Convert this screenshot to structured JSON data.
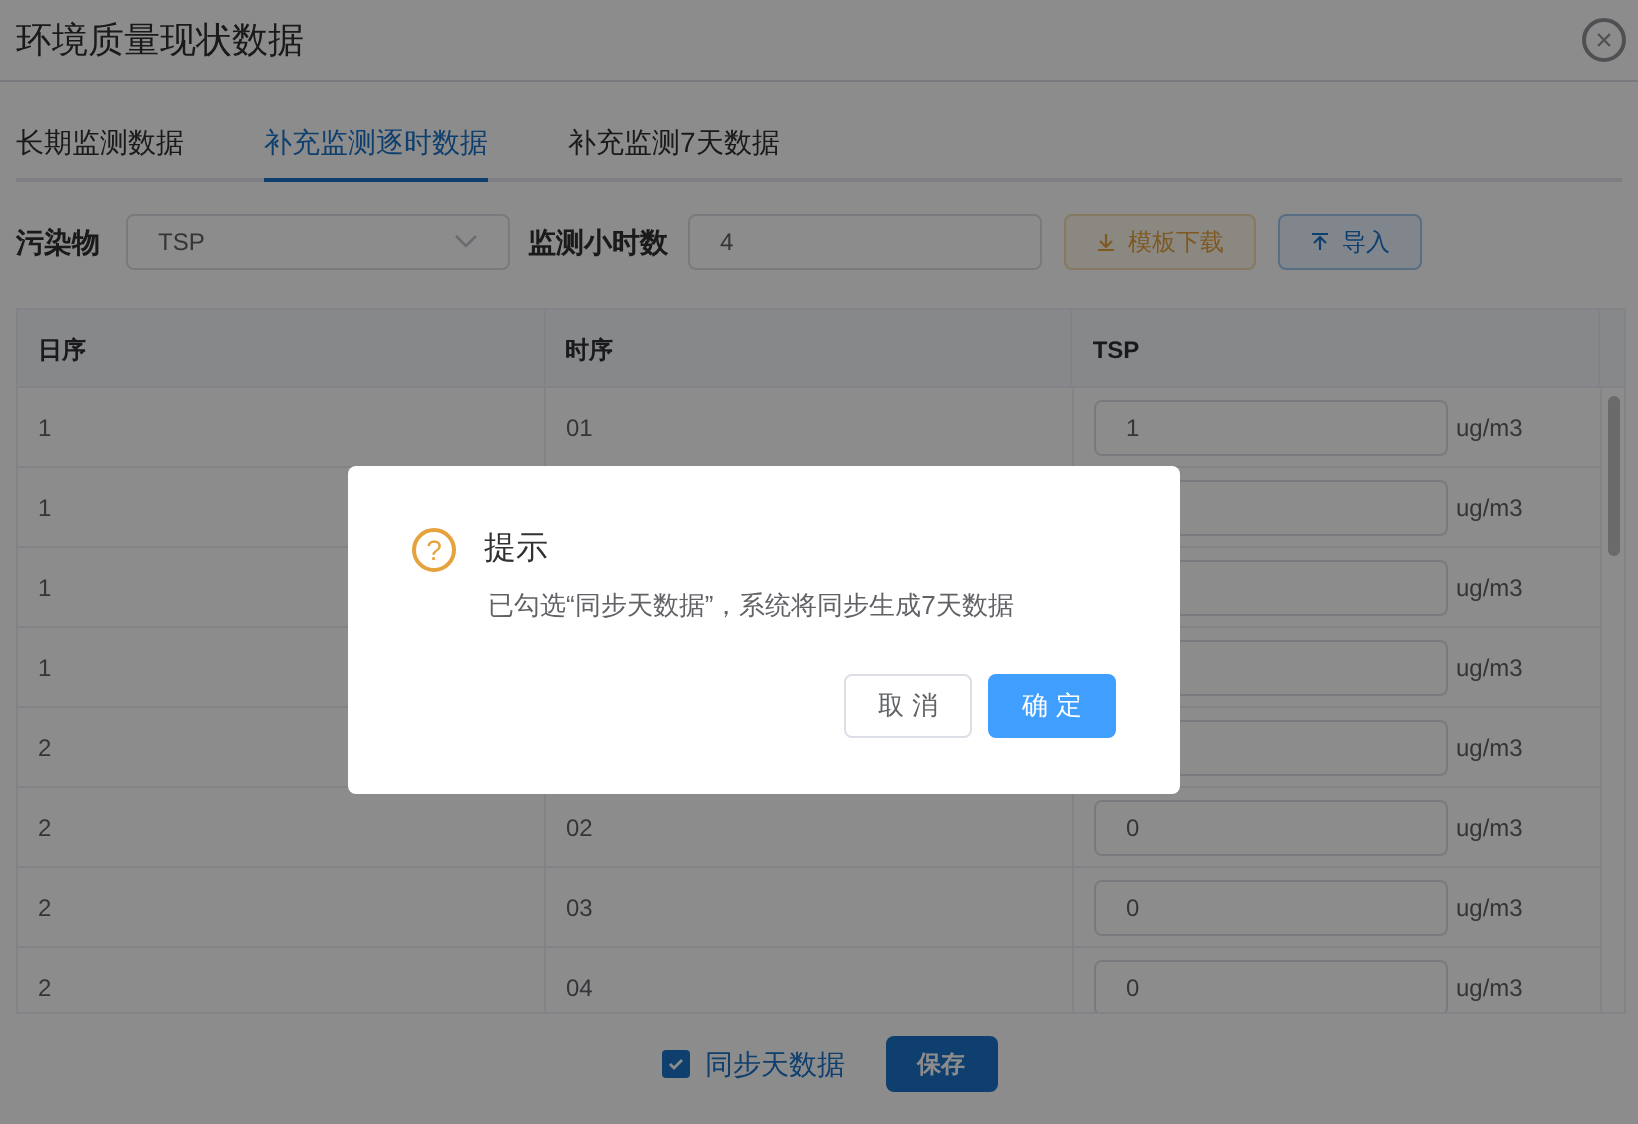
{
  "dialog": {
    "title": "环境质量现状数据",
    "close": "×"
  },
  "tabs": [
    {
      "label": "长期监测数据",
      "selected": false
    },
    {
      "label": "补充监测逐时数据",
      "selected": true
    },
    {
      "label": "补充监测7天数据",
      "selected": false
    }
  ],
  "filters": {
    "pollutant_label": "污染物",
    "pollutant": "TSP",
    "hours_label": "监测小时数",
    "hours": "4",
    "template_button": "模板下载",
    "import_button": "导入"
  },
  "table": {
    "columns": [
      "日序",
      "时序",
      "TSP"
    ],
    "rows": [
      {
        "day": "1",
        "hour": "01",
        "value": "1",
        "unit": "ug/m3"
      },
      {
        "day": "1",
        "unit": "ug/m3"
      },
      {
        "day": "1",
        "unit": "ug/m3"
      },
      {
        "day": "1",
        "unit": "ug/m3"
      },
      {
        "day": "2",
        "unit": "ug/m3"
      },
      {
        "day": "2",
        "hour": "02",
        "value": "0",
        "unit": "ug/m3"
      },
      {
        "day": "2",
        "hour": "03",
        "value": "0",
        "unit": "ug/m3"
      },
      {
        "day": "2",
        "hour": "04",
        "value": "0",
        "unit": "ug/m3"
      }
    ]
  },
  "footer": {
    "sync_label": "同步天数据",
    "sync_checked": true,
    "save_button": "保存"
  },
  "message_box": {
    "title": "提示",
    "icon": "?",
    "message": "已勾选“同步天数据”，系统将同步生成7天数据",
    "cancel": "取 消",
    "confirm": "确 定"
  }
}
